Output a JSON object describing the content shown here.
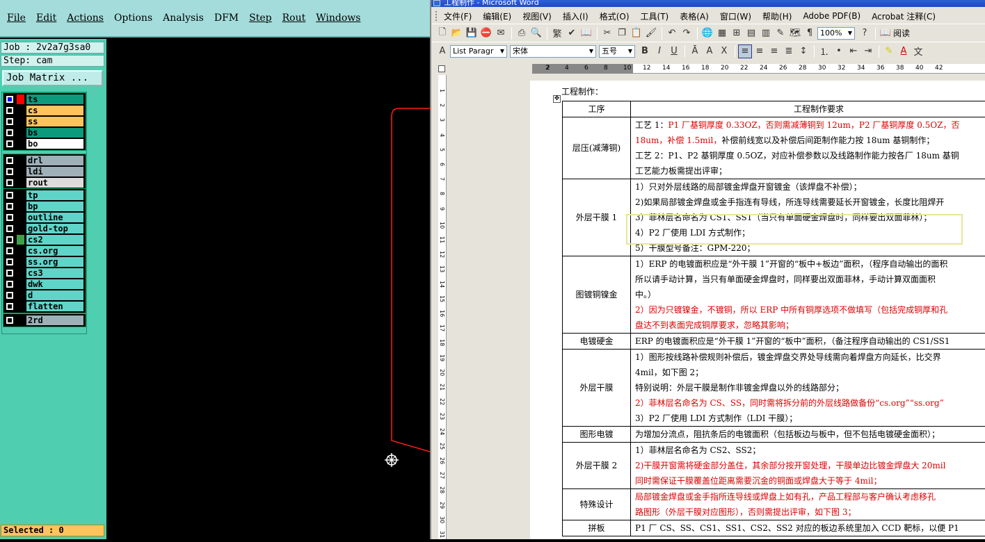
{
  "cam": {
    "menu": [
      "File",
      "Edit",
      "Actions",
      "Options",
      "Analysis",
      "DFM",
      "Step",
      "Rout",
      "Windows"
    ],
    "job_label": "Job : 2v2a7g3sa0",
    "step_label": "Step: cam",
    "job_matrix_button": "Job Matrix ...",
    "layer_groups": [
      [
        {
          "name": "ts",
          "color": "#0c9a7c",
          "swatch": "#ff0000",
          "selected": true
        },
        {
          "name": "cs",
          "color": "#fdc35d",
          "swatch": "#000000"
        },
        {
          "name": "ss",
          "color": "#fdc35d",
          "swatch": "#000000"
        },
        {
          "name": "bs",
          "color": "#0c9a7c",
          "swatch": "#000000"
        },
        {
          "name": "bo",
          "color": "#ffffff",
          "swatch": "#000000"
        }
      ],
      [
        {
          "name": "drl",
          "color": "#9fb0b8",
          "swatch": "#000000"
        },
        {
          "name": "ldi",
          "color": "#9fb0b8",
          "swatch": "#000000"
        },
        {
          "name": "rout",
          "color": "#dcdcdc",
          "swatch": "#000000"
        }
      ],
      [
        {
          "name": "tp",
          "color": "#5fd4c8",
          "swatch": "#000000"
        },
        {
          "name": "bp",
          "color": "#5fd4c8",
          "swatch": "#000000"
        },
        {
          "name": "outline",
          "color": "#5fd4c8",
          "swatch": "#000000"
        },
        {
          "name": "gold-top",
          "color": "#5fd4c8",
          "swatch": "#000000"
        },
        {
          "name": "cs2",
          "color": "#5fd4c8",
          "swatch": "#3aa24a"
        },
        {
          "name": "cs.org",
          "color": "#5fd4c8",
          "swatch": "#000000"
        },
        {
          "name": "ss.org",
          "color": "#5fd4c8",
          "swatch": "#000000"
        },
        {
          "name": "cs3",
          "color": "#5fd4c8",
          "swatch": "#000000"
        },
        {
          "name": "dwk",
          "color": "#5fd4c8",
          "swatch": "#000000"
        },
        {
          "name": "d",
          "color": "#5fd4c8",
          "swatch": "#000000"
        },
        {
          "name": "flatten",
          "color": "#5fd4c8",
          "swatch": "#000000"
        }
      ],
      [
        {
          "name": "2rd",
          "color": "#9fb0b8",
          "swatch": "#000000"
        }
      ]
    ],
    "selected_label": "Selected : 0"
  },
  "word": {
    "title": "工程制作 - Microsoft Word",
    "menu": [
      "文件(F)",
      "编辑(E)",
      "视图(V)",
      "插入(I)",
      "格式(O)",
      "工具(T)",
      "表格(A)",
      "窗口(W)",
      "帮助(H)",
      "Adobe PDF(B)",
      "Acrobat 注释(C)"
    ],
    "zoom": "100%",
    "read_button": "阅读",
    "style_combo": "List Paragr",
    "font_combo": "宋体",
    "size_combo": "五号",
    "ruler_numbers": [
      "2",
      "2",
      "4",
      "6",
      "8",
      "10",
      "12",
      "14",
      "16",
      "18",
      "20",
      "22",
      "24",
      "26",
      "28",
      "30",
      "32",
      "34",
      "36",
      "38",
      "40",
      "42"
    ],
    "vruler_numbers": [
      "1",
      "2",
      "3",
      "4",
      "5",
      "6",
      "7",
      "8",
      "9",
      "10",
      "11",
      "12",
      "13",
      "14",
      "15",
      "16",
      "17",
      "18",
      "19",
      "20",
      "21",
      "22",
      "23",
      "24",
      "25",
      "26",
      "27",
      "28",
      "29",
      "30",
      "31"
    ],
    "doc_heading": "工程制作：",
    "table_header": [
      "工序",
      "工程制作要求"
    ],
    "rows": [
      {
        "proc": "层压(减薄铜)",
        "lines": [
          [
            {
              "t": "工艺 1："
            },
            {
              "t": "P1 厂基铜厚度 0.33OZ，否则需减薄铜到 12um，P2 厂基铜厚度 0.5OZ，否",
              "red": true
            }
          ],
          [
            {
              "t": "18um，补偿 1.5mil，",
              "red": true
            },
            {
              "t": "补偿前线宽以及补偿后间距制作能力按 18um 基铜制作；"
            }
          ],
          [
            {
              "t": "工艺 2：P1、P2 基铜厚度 0.5OZ，对应补偿参数以及线路制作能力按各厂 18um 基铜"
            }
          ],
          [
            {
              "t": "工艺能力板需提出评审；"
            }
          ]
        ]
      },
      {
        "proc": "外层干膜 1",
        "lines": [
          [
            {
              "t": "1）只对外层线路的局部镀金焊盘开窗镀金（该焊盘不补偿）；"
            }
          ],
          [
            {
              "t": "2)如果局部镀金焊盘或金手指连有导线，所连导线需要延长开窗镀金，长度比阻焊开"
            }
          ],
          [
            {
              "t": "3）菲林层名命名为 CS1、SS1（当只有单面硬金焊盘时，同样要出双面菲林）；"
            }
          ],
          [
            {
              "t": "4）P2 厂使用 LDI 方式制作；"
            }
          ],
          [
            {
              "t": "5）干膜型号备注：GPM-220；"
            }
          ]
        ]
      },
      {
        "proc": "图镀铜镍金",
        "lines": [
          [
            {
              "t": "1）ERP 的电镀面积应是“外干膜 1”开窗的“板中+板边”面积，（程序自动输出的面积"
            }
          ],
          [
            {
              "t": "所以请手动计算，当只有单面硬金焊盘时，同样要出双面菲林，手动计算双面面积"
            }
          ],
          [
            {
              "t": "中。）"
            }
          ],
          [
            {
              "t": "2）因为只镀镍金，不镀铜，所以 ERP 中所有铜厚选项不做填写（包括完成铜厚和孔",
              "red": true
            }
          ],
          [
            {
              "t": "盘达不到表面完成铜厚要求，忽略其影响；",
              "red": true
            }
          ]
        ]
      },
      {
        "proc": "电镀硬金",
        "lines": [
          [
            {
              "t": "ERP 的电镀面积应是“外干膜 1”开窗的“板中”面积，（备注程序自动输出的 CS1/SS1"
            }
          ]
        ]
      },
      {
        "proc": "外层干膜",
        "lines": [
          [
            {
              "t": "1）图形按线路补偿规则补偿后，镀金焊盘交界处导线需向着焊盘方向延长，比交界"
            }
          ],
          [
            {
              "t": "4mil，如下图 2；"
            }
          ],
          [
            {
              "t": "特别说明：外层干膜是制作非镀金焊盘以外的线路部分；"
            }
          ],
          [
            {
              "t": "2）菲林层名命名为 CS、SS，同时需将拆分前的外层线路做备份“cs.org”“ss.org”",
              "red": true
            }
          ],
          [
            {
              "t": "3）P2 厂使用 LDI 方式制作（LDI 干膜）；"
            }
          ]
        ]
      },
      {
        "proc": "图形电镀",
        "lines": [
          [
            {
              "t": "为增加分流点，阻抗条后的电镀面积（包括板边与板中，但不包括电镀硬金面积）；"
            }
          ]
        ]
      },
      {
        "proc": "外层干膜 2",
        "lines": [
          [
            {
              "t": "1）菲林层名命名为 CS2、SS2；"
            }
          ],
          [
            {
              "t": "2)干膜开窗需将硬金部分盖住，其余部分按开窗处理，干膜单边比镀金焊盘大 20mil",
              "red": true
            }
          ],
          [
            {
              "t": "同时需保证干膜覆盖位距离需要沉金的铜面或焊盘大于等于 4mil；",
              "red": true
            }
          ]
        ]
      },
      {
        "proc": "特殊设计",
        "lines": [
          [
            {
              "t": "局部镀金焊盘或金手指所连导线或焊盘上如有孔，产品工程部与客户确认考虑移孔",
              "red": true
            }
          ],
          [
            {
              "t": "路图形（外层干膜对应图形），否则需提出评审，如下图 3；",
              "red": true
            }
          ]
        ]
      },
      {
        "proc": "拼板",
        "lines": [
          [
            {
              "t": "P1 厂 CS、SS、CS1、SS1、CS2、SS2 对应的板边系统里加入 CCD 靶标，以便 P1"
            }
          ]
        ]
      }
    ]
  }
}
